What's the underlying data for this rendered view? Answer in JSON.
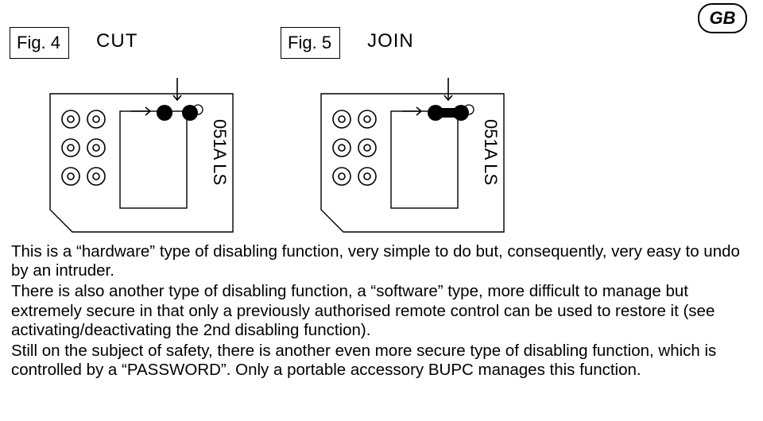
{
  "badge": "GB",
  "figures": [
    {
      "label": "Fig. 4",
      "op": "CUT",
      "pcbLabel": "051A LS",
      "joined": false
    },
    {
      "label": "Fig. 5",
      "op": "JOIN",
      "pcbLabel": "051A LS",
      "joined": true
    }
  ],
  "paragraphs": [
    "This is a “hardware” type of disabling function, very simple to do but, consequently, very easy to undo by an intruder.",
    "There is also another type of disabling function, a “software” type, more difficult to manage but extremely secure in that only a previously authorised remote control can be used to restore it (see activating/deactivating the 2nd disabling function).",
    "Still on the subject of safety, there is another even more secure type of disabling function, which is controlled by a “PASSWORD”. Only a portable accessory BUPC manages this function."
  ]
}
